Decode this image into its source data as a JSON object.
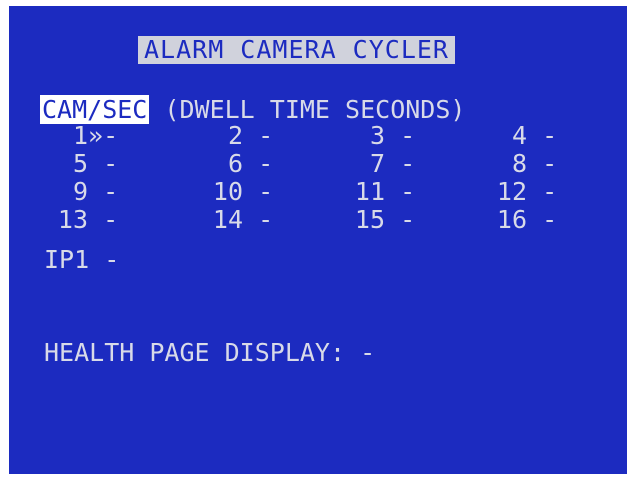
{
  "screen": {
    "title": "ALARM CAMERA CYCLER",
    "header": {
      "selected_label": "CAM/SEC",
      "description": "(DWELL TIME SECONDS)"
    },
    "cameras": [
      [
        {
          "num": "1",
          "sep": "»",
          "value": "-"
        },
        {
          "num": "2",
          "sep": " ",
          "value": "-"
        },
        {
          "num": "3",
          "sep": " ",
          "value": "-"
        },
        {
          "num": "4",
          "sep": " ",
          "value": "-"
        }
      ],
      [
        {
          "num": "5",
          "sep": " ",
          "value": "-"
        },
        {
          "num": "6",
          "sep": " ",
          "value": "-"
        },
        {
          "num": "7",
          "sep": " ",
          "value": "-"
        },
        {
          "num": "8",
          "sep": " ",
          "value": "-"
        }
      ],
      [
        {
          "num": "9",
          "sep": " ",
          "value": "-"
        },
        {
          "num": "10",
          "sep": " ",
          "value": "-"
        },
        {
          "num": "11",
          "sep": " ",
          "value": "-"
        },
        {
          "num": "12",
          "sep": " ",
          "value": "-"
        }
      ],
      [
        {
          "num": "13",
          "sep": " ",
          "value": "-"
        },
        {
          "num": "14",
          "sep": " ",
          "value": "-"
        },
        {
          "num": "15",
          "sep": " ",
          "value": "-"
        },
        {
          "num": "16",
          "sep": " ",
          "value": "-"
        }
      ]
    ],
    "ip": {
      "label": "IP1",
      "value": "-"
    },
    "health": {
      "label": "HEALTH PAGE DISPLAY:",
      "value": "-"
    },
    "colors": {
      "background": "#1c2bc0",
      "text": "#d8dae8",
      "highlight": "#ffffff"
    }
  }
}
